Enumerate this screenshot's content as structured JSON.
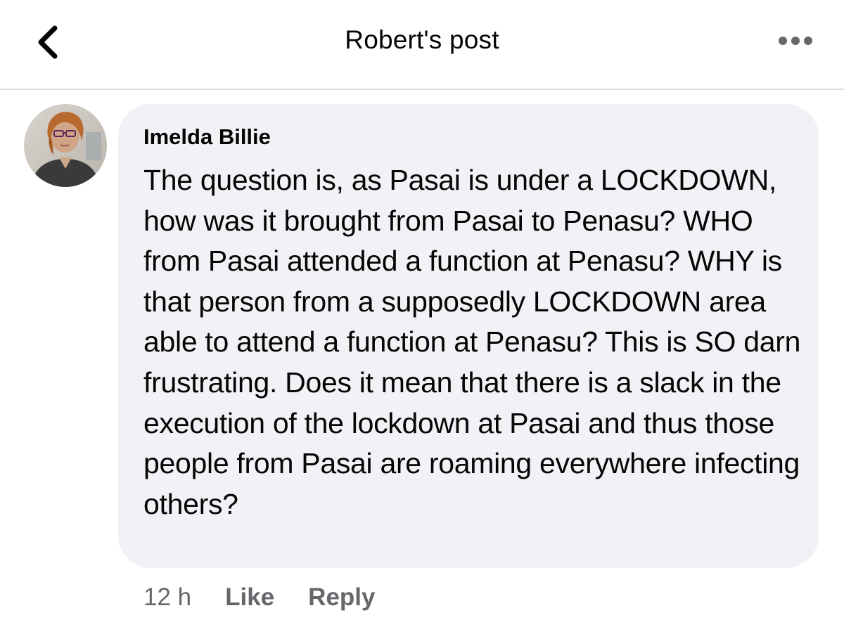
{
  "header": {
    "title": "Robert's post",
    "back_icon": "chevron-left-icon",
    "more_icon": "more-horizontal-icon"
  },
  "comment": {
    "author": "Imelda Billie",
    "text": "The question is, as Pasai is under a LOCKDOWN, how was it brought from Pasai to Penasu? WHO from Pasai attended a function at Penasu? WHY is that person from a supposedly LOCKDOWN area able to attend a function at Penasu? This is SO darn frustrating. Does it mean that there is a slack in the execution of the lockdown at Pasai and thus those people from Pasai are roaming everywhere infecting others?",
    "time": "12 h",
    "like_label": "Like",
    "reply_label": "Reply"
  },
  "colors": {
    "bubble_bg": "#f0f2f5",
    "secondary_text": "#65676b",
    "primary_text": "#050505",
    "divider": "#dadde1"
  }
}
